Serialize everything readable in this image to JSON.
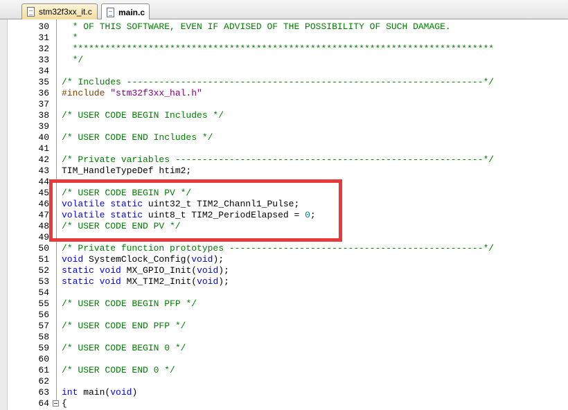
{
  "tabs": [
    {
      "label": "stm32f3xx_it.c",
      "active": false
    },
    {
      "label": "main.c",
      "active": true
    }
  ],
  "lines": [
    {
      "n": "30",
      "segs": [
        {
          "c": "cm",
          "t": "  * OF THIS SOFTWARE, EVEN IF ADVISED OF THE POSSIBILITY OF SUCH DAMAGE."
        }
      ]
    },
    {
      "n": "31",
      "segs": [
        {
          "c": "cm",
          "t": "  *"
        }
      ]
    },
    {
      "n": "32",
      "segs": [
        {
          "c": "cm",
          "t": "  ******************************************************************************"
        }
      ]
    },
    {
      "n": "33",
      "segs": [
        {
          "c": "cm",
          "t": "  */"
        }
      ]
    },
    {
      "n": "34",
      "segs": []
    },
    {
      "n": "35",
      "segs": [
        {
          "c": "cm",
          "t": "/* Includes ------------------------------------------------------------------*/"
        }
      ]
    },
    {
      "n": "36",
      "segs": [
        {
          "c": "pp",
          "t": "#include "
        },
        {
          "c": "str",
          "t": "\"stm32f3xx_hal.h\""
        }
      ]
    },
    {
      "n": "37",
      "segs": []
    },
    {
      "n": "38",
      "segs": [
        {
          "c": "cm",
          "t": "/* USER CODE BEGIN Includes */"
        }
      ]
    },
    {
      "n": "39",
      "segs": []
    },
    {
      "n": "40",
      "segs": [
        {
          "c": "cm",
          "t": "/* USER CODE END Includes */"
        }
      ]
    },
    {
      "n": "41",
      "segs": []
    },
    {
      "n": "42",
      "segs": [
        {
          "c": "cm",
          "t": "/* Private variables ---------------------------------------------------------*/"
        }
      ]
    },
    {
      "n": "43",
      "segs": [
        {
          "c": "tx",
          "t": "TIM_HandleTypeDef htim2;"
        }
      ]
    },
    {
      "n": "44",
      "segs": []
    },
    {
      "n": "45",
      "segs": [
        {
          "c": "cm",
          "t": "/* USER CODE BEGIN PV */"
        }
      ]
    },
    {
      "n": "46",
      "segs": [
        {
          "c": "kw",
          "t": "volatile"
        },
        {
          "c": "tx",
          "t": " "
        },
        {
          "c": "kw",
          "t": "static"
        },
        {
          "c": "tx",
          "t": " uint32_t TIM2_Channl1_Pulse;"
        }
      ]
    },
    {
      "n": "47",
      "segs": [
        {
          "c": "kw",
          "t": "volatile"
        },
        {
          "c": "tx",
          "t": " "
        },
        {
          "c": "kw",
          "t": "static"
        },
        {
          "c": "tx",
          "t": " uint8_t TIM2_PeriodElapsed = "
        },
        {
          "c": "num",
          "t": "0"
        },
        {
          "c": "tx",
          "t": ";"
        }
      ]
    },
    {
      "n": "48",
      "segs": [
        {
          "c": "cm",
          "t": "/* USER CODE END PV */"
        }
      ]
    },
    {
      "n": "49",
      "segs": []
    },
    {
      "n": "50",
      "segs": [
        {
          "c": "cm",
          "t": "/* Private function prototypes -----------------------------------------------*/"
        }
      ]
    },
    {
      "n": "51",
      "segs": [
        {
          "c": "kw",
          "t": "void"
        },
        {
          "c": "tx",
          "t": " SystemClock_Config("
        },
        {
          "c": "kw",
          "t": "void"
        },
        {
          "c": "tx",
          "t": ");"
        }
      ]
    },
    {
      "n": "52",
      "segs": [
        {
          "c": "kw",
          "t": "static"
        },
        {
          "c": "tx",
          "t": " "
        },
        {
          "c": "kw",
          "t": "void"
        },
        {
          "c": "tx",
          "t": " MX_GPIO_Init("
        },
        {
          "c": "kw",
          "t": "void"
        },
        {
          "c": "tx",
          "t": ");"
        }
      ]
    },
    {
      "n": "53",
      "segs": [
        {
          "c": "kw",
          "t": "static"
        },
        {
          "c": "tx",
          "t": " "
        },
        {
          "c": "kw",
          "t": "void"
        },
        {
          "c": "tx",
          "t": " MX_TIM2_Init("
        },
        {
          "c": "kw",
          "t": "void"
        },
        {
          "c": "tx",
          "t": ");"
        }
      ]
    },
    {
      "n": "54",
      "segs": []
    },
    {
      "n": "55",
      "segs": [
        {
          "c": "cm",
          "t": "/* USER CODE BEGIN PFP */"
        }
      ]
    },
    {
      "n": "56",
      "segs": []
    },
    {
      "n": "57",
      "segs": [
        {
          "c": "cm",
          "t": "/* USER CODE END PFP */"
        }
      ]
    },
    {
      "n": "58",
      "segs": []
    },
    {
      "n": "59",
      "segs": [
        {
          "c": "cm",
          "t": "/* USER CODE BEGIN 0 */"
        }
      ]
    },
    {
      "n": "60",
      "segs": []
    },
    {
      "n": "61",
      "segs": [
        {
          "c": "cm",
          "t": "/* USER CODE END 0 */"
        }
      ]
    },
    {
      "n": "62",
      "segs": []
    },
    {
      "n": "63",
      "segs": [
        {
          "c": "kw",
          "t": "int"
        },
        {
          "c": "tx",
          "t": " main("
        },
        {
          "c": "kw",
          "t": "void"
        },
        {
          "c": "tx",
          "t": ")"
        }
      ]
    },
    {
      "n": "64",
      "segs": [
        {
          "c": "tx",
          "t": "{"
        }
      ]
    }
  ],
  "colors": {
    "comment": "#008000",
    "keyword": "#0000ff",
    "preprocessor": "#804000",
    "string": "#800080",
    "number": "#008080",
    "highlight_box": "#e83a3a"
  },
  "icons": {
    "tab_file": "document-icon",
    "fold": "fold-collapse-icon"
  }
}
